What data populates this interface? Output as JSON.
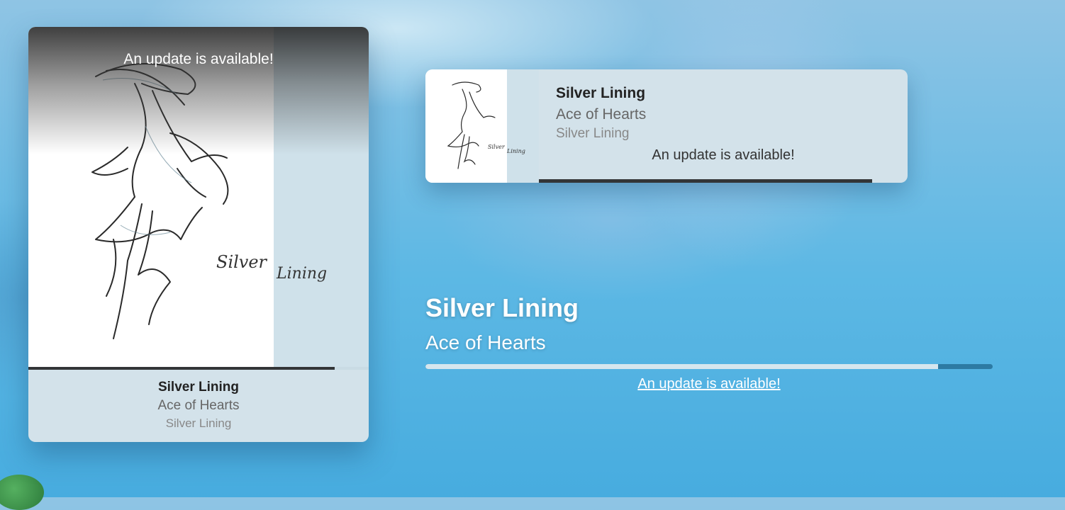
{
  "colors": {
    "card_background": "#d3e2ea",
    "progress_fill_dark": "#333537",
    "inline_progress_track": "#2d7aa3",
    "inline_progress_fill": "#d6e6ee",
    "sky": "#5db8e4"
  },
  "large_widget": {
    "update_notice": "An update is available!",
    "artwork_script": [
      "Silver",
      "Lining"
    ],
    "track_title": "Silver Lining",
    "artist": "Ace of Hearts",
    "album": "Silver Lining",
    "progress_percent": 90
  },
  "compact_widget": {
    "artwork_script": [
      "Silver",
      "Lining"
    ],
    "track_title": "Silver Lining",
    "artist": "Ace of Hearts",
    "album": "Silver Lining",
    "update_notice": "An update is available!",
    "progress_percent": 100
  },
  "inline_widget": {
    "track_title": "Silver Lining",
    "artist": "Ace of Hearts",
    "update_link": "An update is available!",
    "progress_percent": 90.4
  }
}
